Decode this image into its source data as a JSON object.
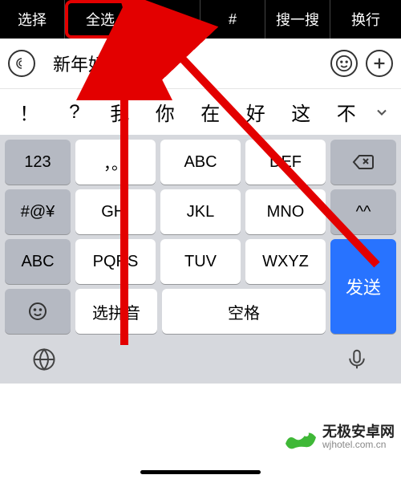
{
  "top_menu": {
    "select": "选择",
    "select_all": "全选",
    "scan": "⌕",
    "hash": "#",
    "search": "搜一搜",
    "newline": "换行"
  },
  "input": {
    "text": "新年好！"
  },
  "suggestions": {
    "s0": "！",
    "s1": "?",
    "s2": "我",
    "s3": "你",
    "s4": "在",
    "s5": "好",
    "s6": "这",
    "s7": "不"
  },
  "keys": {
    "k123": "123",
    "punct": "，。",
    "abc1": "ABC",
    "def": "DEF",
    "backspace": "⌫",
    "sym": "#@¥",
    "ghi": "GHI",
    "jkl": "JKL",
    "mno": "MNO",
    "smile": "^^",
    "abc2": "ABC",
    "pqrs": "PQRS",
    "tuv": "TUV",
    "wxyz": "WXYZ",
    "emoji": "☺",
    "pinyin": "选拼音",
    "space": "空格",
    "send": "发送"
  },
  "watermark": {
    "title": "无极安卓网",
    "url": "wjhotel.com.cn"
  }
}
